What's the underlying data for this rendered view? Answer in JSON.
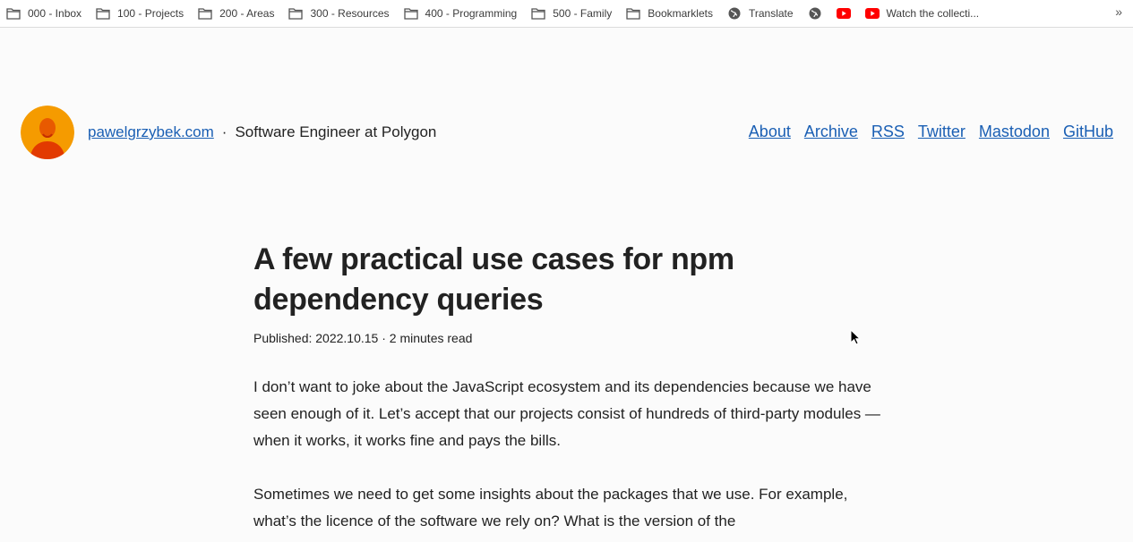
{
  "bookmarks": [
    {
      "label": "000 - Inbox",
      "icon": "folder-icon"
    },
    {
      "label": "100 - Projects",
      "icon": "folder-icon"
    },
    {
      "label": "200 - Areas",
      "icon": "folder-icon"
    },
    {
      "label": "300 - Resources",
      "icon": "folder-icon"
    },
    {
      "label": "400 - Programming",
      "icon": "folder-icon"
    },
    {
      "label": "500 - Family",
      "icon": "folder-icon"
    },
    {
      "label": "Bookmarklets",
      "icon": "folder-icon"
    },
    {
      "label": "Translate",
      "icon": "globe-icon"
    },
    {
      "label": "",
      "icon": "globe-icon"
    },
    {
      "label": "",
      "icon": "youtube-icon"
    },
    {
      "label": "Watch the collecti...",
      "icon": "youtube-icon"
    }
  ],
  "bookmarks_overflow": "»",
  "site": {
    "domain": "pawelgrzybek.com",
    "separator": "·",
    "tagline": "Software Engineer at Polygon"
  },
  "nav": [
    "About",
    "Archive",
    "RSS",
    "Twitter",
    "Mastodon",
    "GitHub"
  ],
  "article": {
    "title_line1": "A few practical use cases for npm",
    "title_line2": "dependency queries",
    "meta": "Published: 2022.10.15 · 2 minutes read",
    "paragraph1": "I don’t want to joke about the JavaScript ecosystem and its dependencies because we have seen enough of it. Let’s accept that our projects consist of hundreds of third-party modules — when it works, it works fine and pays the bills.",
    "paragraph2": "Sometimes we need to get some insights about the packages that we use. For example, what’s the licence of the software we rely on? What is the version of the"
  },
  "colors": {
    "link": "#1a5fb4",
    "text": "#222222",
    "youtube": "#ff0000",
    "avatar": "#f59b00"
  }
}
